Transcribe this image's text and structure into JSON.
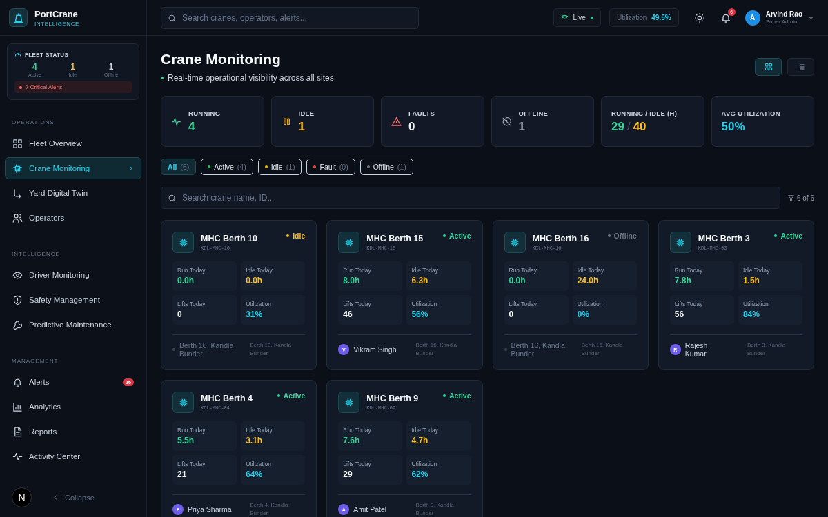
{
  "brand": {
    "name": "PortCrane",
    "tagline": "INTELLIGENCE"
  },
  "fleet_status": {
    "title": "FLEET STATUS",
    "counts": [
      {
        "kind": "active",
        "value": "4",
        "label": "Active"
      },
      {
        "kind": "idle",
        "value": "1",
        "label": "Idle"
      },
      {
        "kind": "offline",
        "value": "1",
        "label": "Offline"
      }
    ],
    "alert": "7 Critical Alerts"
  },
  "sidebar": {
    "sections": [
      {
        "title": "OPERATIONS",
        "items": [
          {
            "label": "Fleet Overview",
            "selected": false
          },
          {
            "label": "Crane Monitoring",
            "selected": true
          },
          {
            "label": "Yard Digital Twin",
            "selected": false
          },
          {
            "label": "Operators",
            "selected": false
          }
        ]
      },
      {
        "title": "INTELLIGENCE",
        "items": [
          {
            "label": "Driver Monitoring",
            "selected": false
          },
          {
            "label": "Safety Management",
            "selected": false
          },
          {
            "label": "Predictive Maintenance",
            "selected": false
          }
        ]
      },
      {
        "title": "MANAGEMENT",
        "items": [
          {
            "label": "Alerts",
            "selected": false,
            "badge": "16"
          },
          {
            "label": "Analytics",
            "selected": false
          },
          {
            "label": "Reports",
            "selected": false
          },
          {
            "label": "Activity Center",
            "selected": false
          }
        ]
      }
    ],
    "footer_logo": "N",
    "collapse": "Collapse"
  },
  "topbar": {
    "search": {
      "placeholder": "Search cranes, operators, alerts..."
    },
    "live": "Live",
    "utilization_label": "Utilization",
    "utilization_value": "49.5%",
    "notifications": "6",
    "user": {
      "initial": "A",
      "name": "Arvind Rao",
      "role": "Super Admin"
    }
  },
  "page": {
    "title": "Crane Monitoring",
    "subtitle": "Real-time operational visibility across all sites"
  },
  "view_toggle": [
    {
      "selected": true
    },
    {
      "selected": false
    }
  ],
  "stats": [
    {
      "kind": "running",
      "label": "RUNNING",
      "value": "4"
    },
    {
      "kind": "idle",
      "label": "IDLE",
      "value": "1"
    },
    {
      "kind": "faults",
      "label": "FAULTS",
      "value": "0"
    },
    {
      "kind": "offline",
      "label": "OFFLINE",
      "value": "1"
    },
    {
      "kind": "ratio",
      "label": "RUNNING / IDLE (H)",
      "value": "29",
      "separator": "/",
      "value2": "40"
    },
    {
      "kind": "utilization",
      "label": "AVG UTILIZATION",
      "value": "50%"
    }
  ],
  "filters": [
    {
      "label": "All",
      "count": "(6)",
      "selected": true
    },
    {
      "label": "Active",
      "count": "(4)",
      "selected": false,
      "color": "#22c55e"
    },
    {
      "label": "Idle",
      "count": "(1)",
      "selected": false,
      "color": "#eab308"
    },
    {
      "label": "Fault",
      "count": "(0)",
      "selected": false,
      "color": "#ef4444"
    },
    {
      "label": "Offline",
      "count": "(1)",
      "selected": false,
      "color": "#6b7280"
    }
  ],
  "crane_search": {
    "placeholder": "Search crane name, ID...",
    "result_count": "6 of 6"
  },
  "cranes": [
    {
      "name": "MHC Berth 10",
      "id": "KDL-MHC-10",
      "status": "Idle",
      "color": "#fbbf24",
      "run_label": "Run Today",
      "run": "0.0h",
      "idle_label": "Idle Today",
      "idle": "0.0h",
      "lifts_label": "Lifts Today",
      "lifts": "0",
      "util_label": "Utilization",
      "util": "31%",
      "place": "Berth 10, Kandla Bunder",
      "location": "Berth 10, Kandla Bunder"
    },
    {
      "name": "MHC Berth 15",
      "id": "KDL-MHC-15",
      "status": "Active",
      "color": "#34d399",
      "run_label": "Run Today",
      "run": "8.0h",
      "idle_label": "Idle Today",
      "idle": "6.3h",
      "lifts_label": "Lifts Today",
      "lifts": "46",
      "util_label": "Utilization",
      "util": "56%",
      "operator_initial": "V",
      "operator": "Vikram Singh",
      "location": "Berth 15, Kandla Bunder"
    },
    {
      "name": "MHC Berth 16",
      "id": "KDL-MHC-16",
      "status": "Offline",
      "color": "#6b7280",
      "run_label": "Run Today",
      "run": "0.0h",
      "idle_label": "Idle Today",
      "idle": "24.0h",
      "lifts_label": "Lifts Today",
      "lifts": "0",
      "util_label": "Utilization",
      "util": "0%",
      "place": "Berth 16, Kandla Bunder",
      "location": "Berth 16, Kandla Bunder"
    },
    {
      "name": "MHC Berth 3",
      "id": "KDL-MHC-03",
      "status": "Active",
      "color": "#34d399",
      "run_label": "Run Today",
      "run": "7.8h",
      "idle_label": "Idle Today",
      "idle": "1.5h",
      "lifts_label": "Lifts Today",
      "lifts": "56",
      "util_label": "Utilization",
      "util": "84%",
      "operator_initial": "R",
      "operator": "Rajesh Kumar",
      "location": "Berth 3, Kandla Bunder"
    },
    {
      "name": "MHC Berth 4",
      "id": "KDL-MHC-04",
      "status": "Active",
      "color": "#34d399",
      "run_label": "Run Today",
      "run": "5.5h",
      "idle_label": "Idle Today",
      "idle": "3.1h",
      "lifts_label": "Lifts Today",
      "lifts": "21",
      "util_label": "Utilization",
      "util": "64%",
      "operator_initial": "P",
      "operator": "Priya Sharma",
      "location": "Berth 4, Kandla Bunder"
    },
    {
      "name": "MHC Berth 9",
      "id": "KDL-MHC-09",
      "status": "Active",
      "color": "#34d399",
      "run_label": "Run Today",
      "run": "7.6h",
      "idle_label": "Idle Today",
      "idle": "4.7h",
      "lifts_label": "Lifts Today",
      "lifts": "29",
      "util_label": "Utilization",
      "util": "62%",
      "operator_initial": "A",
      "operator": "Amit Patel",
      "location": "Berth 9, Kandla Bunder"
    }
  ]
}
